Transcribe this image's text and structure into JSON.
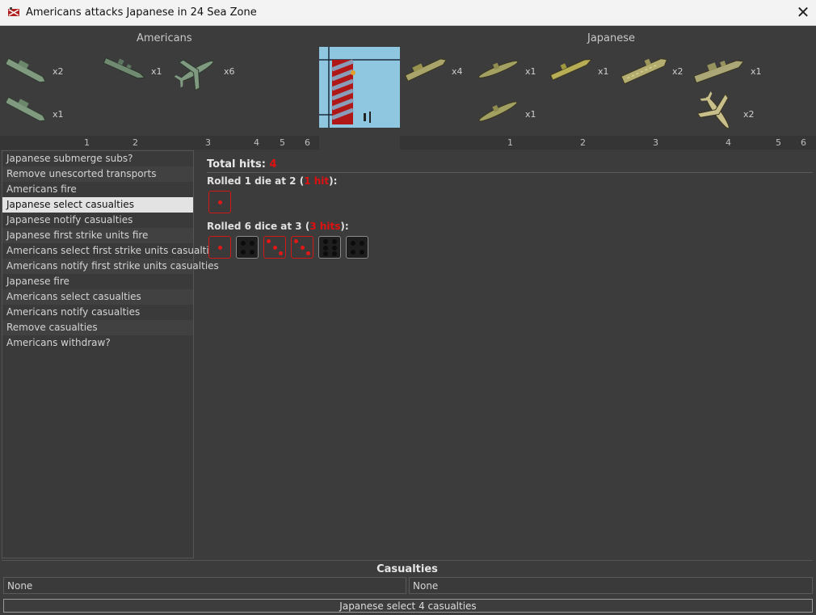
{
  "window": {
    "title": "Americans attacks Japanese in 24 Sea Zone",
    "close_glyph": "✕"
  },
  "attacker": {
    "name": "Americans",
    "units": [
      {
        "type": "transport",
        "count": "x2",
        "color": "#7f9a7f"
      },
      {
        "type": "destroyer",
        "count": "x1",
        "color": "#6f8a70"
      },
      {
        "type": "fighter",
        "count": "x6",
        "color": "#7f9a80"
      },
      {
        "type": "transport",
        "count": "x1",
        "color": "#7f9a7f"
      }
    ],
    "ticks": [
      "1",
      "2",
      "3",
      "4",
      "5",
      "6"
    ]
  },
  "defender": {
    "name": "Japanese",
    "units": [
      {
        "type": "transport",
        "count": "x4",
        "color": "#a9a56a"
      },
      {
        "type": "submarine",
        "count": "x1",
        "color": "#a3a161"
      },
      {
        "type": "destroyer",
        "count": "x1",
        "color": "#b6ad55"
      },
      {
        "type": "carrier",
        "count": "x2",
        "color": "#b4ad70"
      },
      {
        "type": "battleship",
        "count": "x1",
        "color": "#aba777"
      },
      {
        "type": "submarine",
        "count": "x1",
        "color": "#a3a161"
      },
      {
        "type": "fighter",
        "count": "x2",
        "color": "#c8bf8a"
      }
    ],
    "ticks": [
      "1",
      "2",
      "3",
      "4",
      "5",
      "6"
    ]
  },
  "steps": {
    "items": [
      "Japanese submerge subs?",
      "Remove unescorted transports",
      "Americans fire",
      "Japanese select casualties",
      "Japanese notify casualties",
      "Japanese first strike units fire",
      "Americans select first strike units casualties",
      "Americans notify first strike units casualties",
      "Japanese fire",
      "Americans select casualties",
      "Americans notify casualties",
      "Remove casualties",
      "Americans withdraw?"
    ],
    "selected_index": 3
  },
  "results": {
    "total_label": "Total hits: ",
    "total_value": "4",
    "rolls": [
      {
        "prefix": "Rolled 1 die at 2 (",
        "hits": "1 hit",
        "suffix": "):",
        "dice": [
          {
            "value": 1,
            "hit": true
          }
        ]
      },
      {
        "prefix": "Rolled 6 dice at 3 (",
        "hits": "3 hits",
        "suffix": "):",
        "dice": [
          {
            "value": 1,
            "hit": true
          },
          {
            "value": 4,
            "hit": false
          },
          {
            "value": 3,
            "hit": true
          },
          {
            "value": 3,
            "hit": true
          },
          {
            "value": 6,
            "hit": false
          },
          {
            "value": 4,
            "hit": false
          }
        ]
      }
    ]
  },
  "casualties": {
    "title": "Casualties",
    "attacker": "None",
    "defender": "None"
  },
  "action_button": "Japanese select 4 casualties"
}
